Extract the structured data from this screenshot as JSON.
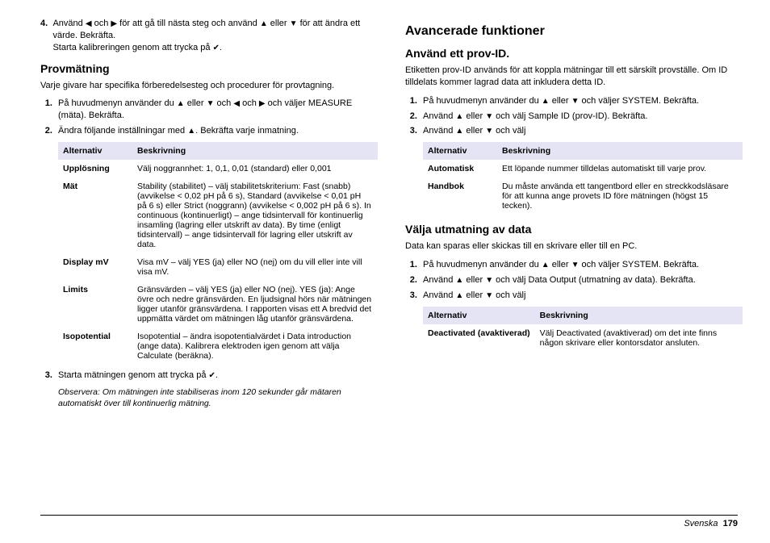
{
  "left": {
    "list1": {
      "num": "4.",
      "text_a": "Använd ",
      "text_b": " och ",
      "text_c": " för att gå till nästa steg och använd ",
      "text_d": " eller ",
      "text_e": " för att ändra ett värde. Bekräfta.",
      "text_f": "Starta kalibreringen genom att trycka på ",
      "text_g": "."
    },
    "h_prov": "Provmätning",
    "p_prov": "Varje givare har specifika förberedelsesteg och procedurer för provtagning.",
    "ol2": {
      "i1_a": "På huvudmenyn använder du ",
      "i1_b": " eller ",
      "i1_c": " och ",
      "i1_d": " och ",
      "i1_e": " och väljer MEASURE (mäta). Bekräfta.",
      "i2_a": "Ändra följande inställningar med ",
      "i2_b": ". Bekräfta varje inmatning.",
      "i3_a": "Starta mätningen genom att trycka på ",
      "i3_b": "."
    },
    "table1": {
      "h1": "Alternativ",
      "h2": "Beskrivning",
      "r1c1": "Upplösning",
      "r1c2": "Välj noggrannhet: 1, 0,1, 0,01 (standard) eller 0,001",
      "r2c1": "Mät",
      "r2c2": "Stability (stabilitet) – välj stabilitetskriterium: Fast (snabb) (avvikelse < 0,02 pH på 6 s), Standard (avvikelse < 0,01 pH på 6 s) eller Strict (noggrann) (avvikelse < 0,002 pH på 6 s). In continuous (kontinuerligt) – ange tidsintervall för kontinuerlig insamling (lagring eller utskrift av data). By time (enligt tidsintervall) – ange tidsintervall för lagring eller utskrift av data.",
      "r3c1": "Display mV",
      "r3c2": "Visa mV – välj YES (ja) eller NO (nej) om du vill eller inte vill visa mV.",
      "r4c1": "Limits",
      "r4c2": "Gränsvärden – välj YES (ja) eller NO (nej). YES (ja): Ange övre och nedre gränsvärden. En ljudsignal hörs när mätningen ligger utanför gränsvärdena. I rapporten visas ett A bredvid det uppmätta värdet om mätningen låg utanför gränsvärdena.",
      "r5c1": "Isopotential",
      "r5c2": "Isopotential – ändra isopotentialvärdet i Data introduction (ange data). Kalibrera elektroden igen genom att välja Calculate (beräkna)."
    },
    "note": "Observera: Om mätningen inte stabiliseras inom 120 sekunder går mätaren automatiskt över till kontinuerlig mätning."
  },
  "right": {
    "h_adv": "Avancerade funktioner",
    "h_prov_id": "Använd ett prov-ID.",
    "p_prov_id": "Etiketten prov-ID används för att koppla mätningar till ett särskilt provställe. Om ID tilldelats kommer lagrad data att inkludera detta ID.",
    "ol1": {
      "i1_a": "På huvudmenyn använder du ",
      "i1_b": " eller ",
      "i1_c": " och väljer SYSTEM. Bekräfta.",
      "i2_a": "Använd ",
      "i2_b": " eller ",
      "i2_c": " och välj Sample ID (prov-ID). Bekräfta.",
      "i3_a": "Använd ",
      "i3_b": " eller ",
      "i3_c": " och välj"
    },
    "table2": {
      "h1": "Alternativ",
      "h2": "Beskrivning",
      "r1c1": "Automatisk",
      "r1c2": "Ett löpande nummer tilldelas automatiskt till varje prov.",
      "r2c1": "Handbok",
      "r2c2": "Du måste använda ett tangentbord eller en streckkodsläsare för att kunna ange provets ID före mätningen (högst 15 tecken)."
    },
    "h_utm": "Välja utmatning av data",
    "p_utm": "Data kan sparas eller skickas till en skrivare eller till en PC.",
    "ol2": {
      "i1_a": "På huvudmenyn använder du ",
      "i1_b": " eller ",
      "i1_c": " och väljer SYSTEM. Bekräfta.",
      "i2_a": "Använd ",
      "i2_b": " eller ",
      "i2_c": " och välj Data Output (utmatning av data). Bekräfta.",
      "i3_a": "Använd ",
      "i3_b": " eller ",
      "i3_c": " och välj"
    },
    "table3": {
      "h1": "Alternativ",
      "h2": "Beskrivning",
      "r1c1": "Deactivated (avaktiverad)",
      "r1c2": "Välj Deactivated (avaktiverad) om det inte finns någon skrivare eller kontorsdator ansluten."
    }
  },
  "footer": {
    "lang": "Svenska",
    "page": "179"
  }
}
